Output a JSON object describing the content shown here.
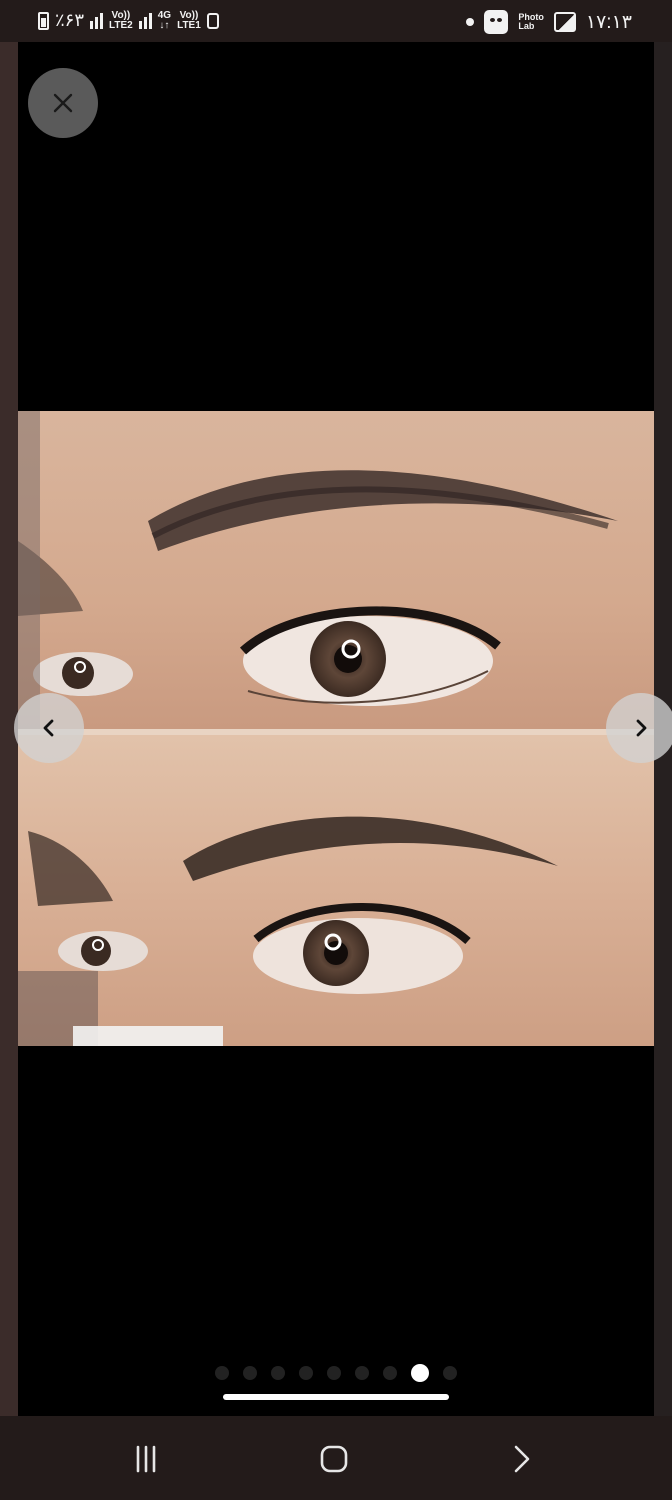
{
  "status_bar": {
    "battery_text": "٪۶۳",
    "sim1_label_top": "Vo))",
    "sim1_label_bottom": "LTE2",
    "net_label_top": "4G",
    "net_label_bottom": "↓↑",
    "sim2_label_top": "Vo))",
    "sim2_label_bottom": "LTE1",
    "photolab_top": "Photo",
    "photolab_bottom": "Lab",
    "time": "۱۷:۱۳"
  },
  "viewer": {
    "current_page": 8,
    "total_pages": 9
  },
  "colors": {
    "accent": "#ffffff",
    "viewer_background": "#000000",
    "system_bar": "#231b1a"
  },
  "icons": {
    "close": "close-icon",
    "previous": "chevron-left-icon",
    "next": "chevron-right-icon",
    "recents": "recents-icon",
    "home": "home-icon",
    "back": "back-icon"
  }
}
